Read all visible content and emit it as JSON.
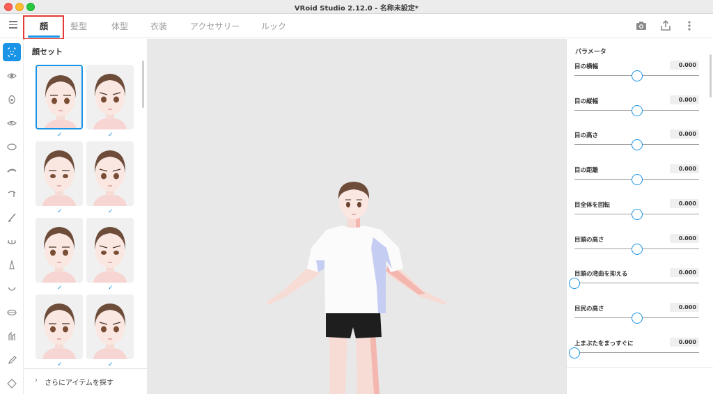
{
  "window": {
    "title": "VRoid Studio 2.12.0 - 名称未設定*"
  },
  "tabs": [
    {
      "label": "顔",
      "active": true
    },
    {
      "label": "髪型"
    },
    {
      "label": "体型"
    },
    {
      "label": "衣装"
    },
    {
      "label": "アクセサリー"
    },
    {
      "label": "ルック"
    }
  ],
  "toolbar_icons": [
    "camera-icon",
    "export-icon",
    "more-vertical-icon"
  ],
  "rail_icons": [
    "face-icon",
    "eye-icon",
    "iris-icon",
    "eye-highlight-icon",
    "face-outline-icon",
    "eyebrow-icon",
    "ear-icon",
    "brush-icon",
    "eyelash-icon",
    "nose-icon",
    "mouth-icon",
    "teeth-icon",
    "tooth-icon",
    "dropper-icon",
    "shape-icon"
  ],
  "face_panel": {
    "title": "顔セット",
    "items_count": 8,
    "selected_index": 0,
    "more_label": "さらにアイテムを探す"
  },
  "params": {
    "title": "パラメータ",
    "items": [
      {
        "label": "目の横幅",
        "value": "0.000",
        "level": 0.5
      },
      {
        "label": "目の縦幅",
        "value": "0.000",
        "level": 0.5
      },
      {
        "label": "目の高さ",
        "value": "0.000",
        "level": 0.5
      },
      {
        "label": "目の距離",
        "value": "0.000",
        "level": 0.5
      },
      {
        "label": "目全体を回転",
        "value": "0.000",
        "level": 0.5
      },
      {
        "label": "目頭の高さ",
        "value": "0.000",
        "level": 0.5
      },
      {
        "label": "目頭の湾曲を抑える",
        "value": "0.000",
        "level": 0.0
      },
      {
        "label": "目尻の高さ",
        "value": "0.000",
        "level": 0.5
      },
      {
        "label": "上まぶたをまっすぐに",
        "value": "0.000",
        "level": 0.0
      }
    ]
  },
  "colors": {
    "accent": "#1a94e6",
    "highlight": "#e53935",
    "viewport_bg": "#e8e8e8"
  }
}
